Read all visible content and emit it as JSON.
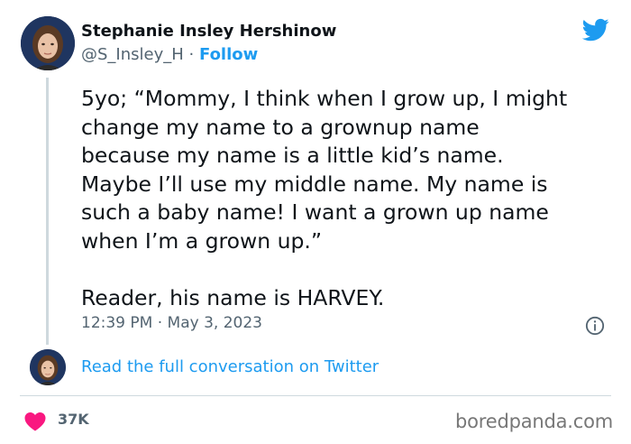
{
  "author": {
    "name": "Stephanie Insley Hershinow",
    "handle": "@S_Insley_H",
    "separator": "·",
    "follow_label": "Follow"
  },
  "tweet": {
    "lines_para1": [
      "5yo; “Mommy, I think when I grow up, I might",
      "change my name to a grownup name",
      "because my name is a little kid’s name.",
      "Maybe I’ll use my middle name. My name is",
      "such a baby name! I want a grown up name",
      "when I’m a grown up.”"
    ],
    "para2": "Reader, his name is HARVEY.",
    "timestamp": "12:39 PM · May 3, 2023"
  },
  "conversation_link": "Read the full conversation on Twitter",
  "likes": {
    "count": "37K"
  },
  "watermark": "boredpanda.com",
  "icons": {
    "platform": "twitter-bird-icon",
    "info": "info-icon",
    "like": "heart-icon"
  },
  "colors": {
    "accent": "#1d9bf0",
    "heart": "#f91880",
    "muted_text": "#536471",
    "thread_line": "#cfd9de"
  }
}
